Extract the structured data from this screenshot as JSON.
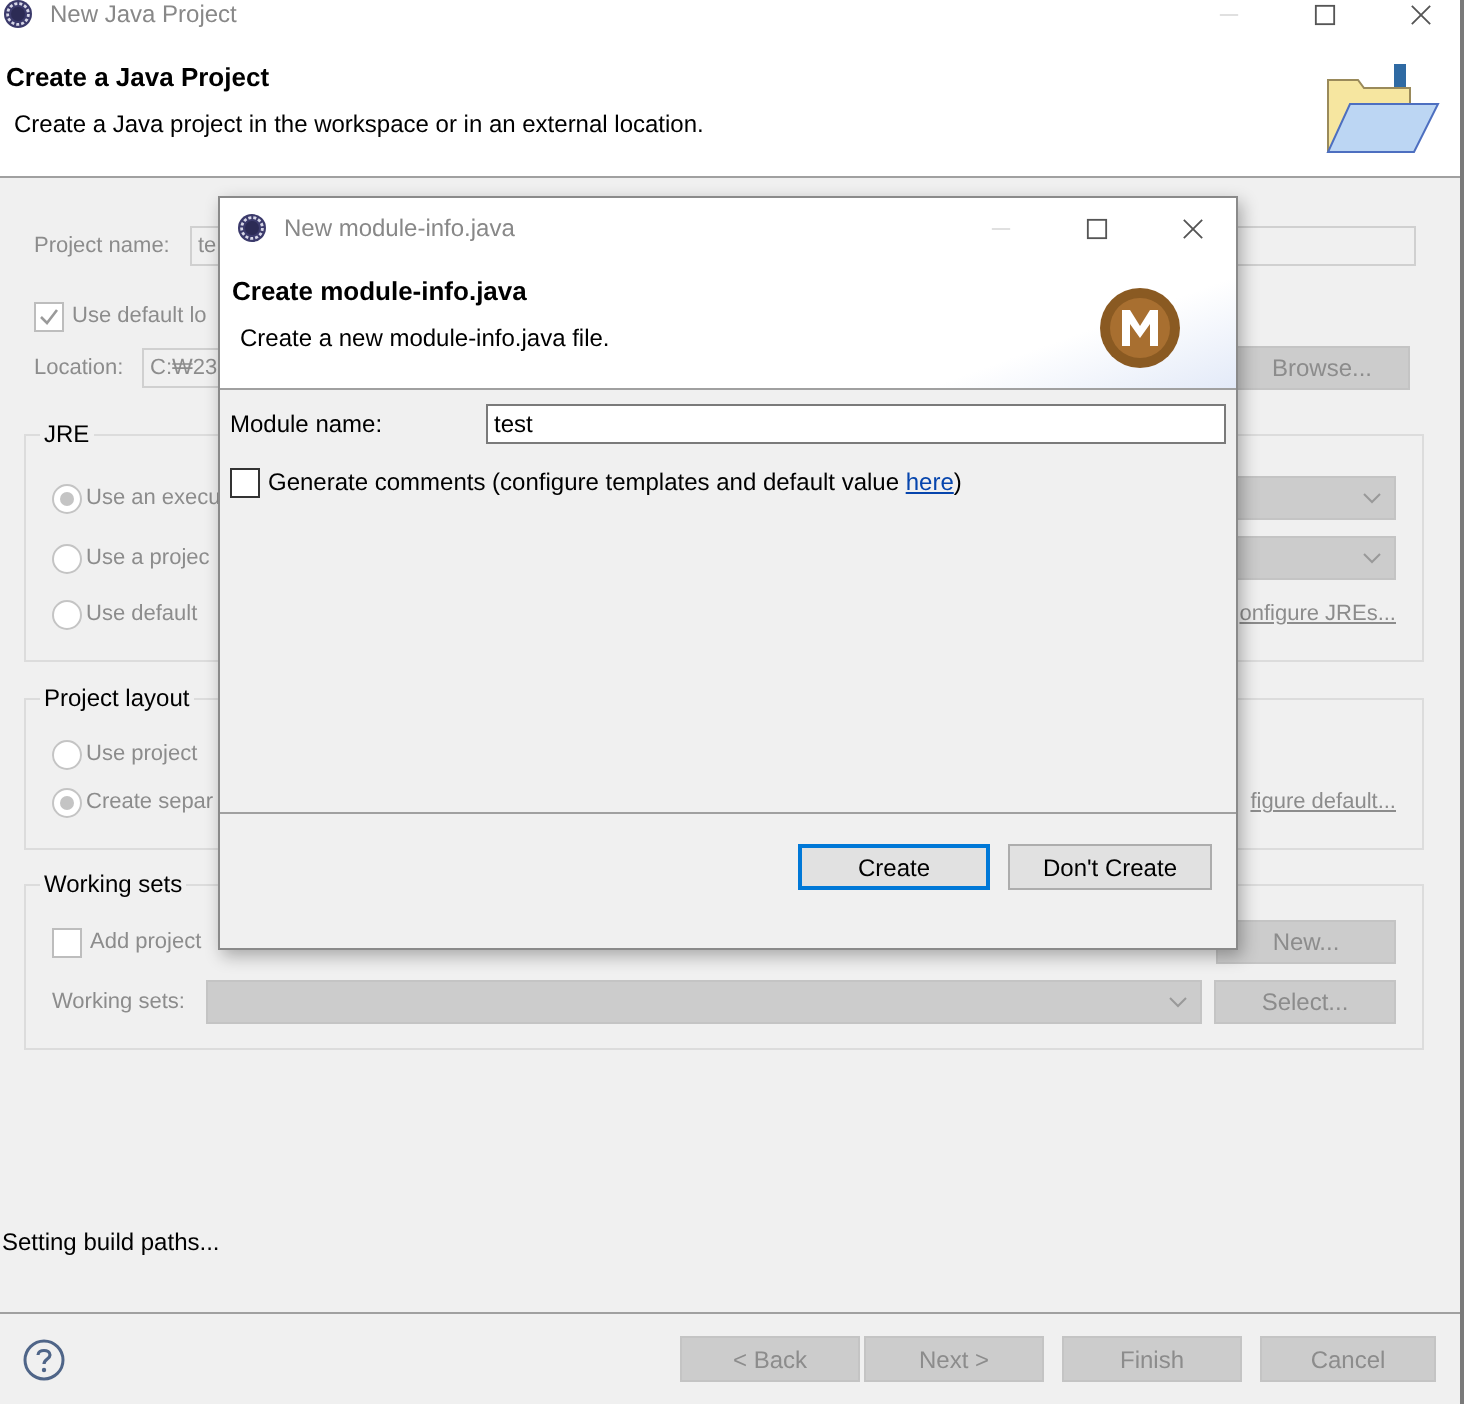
{
  "window": {
    "title": "New Java Project"
  },
  "header": {
    "title": "Create a Java Project",
    "description": "Create a Java project in the workspace or in an external location."
  },
  "project_name": {
    "label": "Project name:",
    "value": "te"
  },
  "use_default_location": {
    "label": "Use default lo",
    "checked": true
  },
  "location": {
    "label": "Location:",
    "value": "C:₩23",
    "button": "Browse..."
  },
  "jre": {
    "title": "JRE",
    "options": [
      {
        "label": "Use an execu",
        "selected": true
      },
      {
        "label": "Use a projec",
        "selected": false
      },
      {
        "label": "Use default",
        "selected": false
      }
    ],
    "link": "onfigure JREs..."
  },
  "project_layout": {
    "title": "Project layout",
    "options": [
      {
        "label": "Use project",
        "selected": false
      },
      {
        "label": "Create separ",
        "selected": true
      }
    ],
    "link": "figure default..."
  },
  "working_sets": {
    "title": "Working sets",
    "add_label": "Add project",
    "checked": false,
    "new_button": "New...",
    "sets_label": "Working sets:",
    "select_button": "Select..."
  },
  "status": "Setting build paths...",
  "buttons": [
    {
      "label": "< Back",
      "disabled": true
    },
    {
      "label": "Next >",
      "disabled": true
    },
    {
      "label": "Finish",
      "disabled": true
    },
    {
      "label": "Cancel",
      "disabled": true
    }
  ],
  "dialog": {
    "title": "New module-info.java",
    "heading": "Create module-info.java",
    "description": "Create a new module-info.java file.",
    "module_name_label": "Module name:",
    "module_name": "test",
    "generate_comments": {
      "checked": false,
      "text": "Generate comments (configure templates and default value ",
      "link": "here",
      "suffix": ")"
    },
    "buttons": [
      {
        "label": "Create",
        "default": true
      },
      {
        "label": "Don't Create",
        "default": false
      }
    ]
  }
}
